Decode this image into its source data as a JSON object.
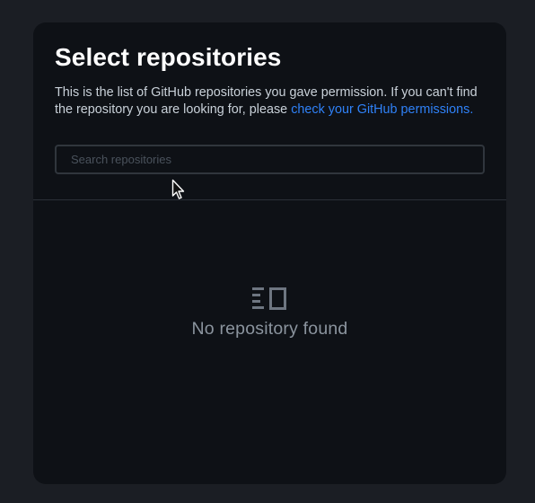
{
  "modal": {
    "title": "Select repositories",
    "description": "This is the list of GitHub repositories you gave permission. If you can't find the repository you are looking for, please ",
    "permissions_link": "check your GitHub permissions.",
    "search": {
      "placeholder": "Search repositories",
      "value": ""
    },
    "empty_state": {
      "icon": "repository-list-icon",
      "message": "No repository found"
    }
  },
  "colors": {
    "page_background": "#1b1e24",
    "modal_background": "#0e1116",
    "link": "#2f81f7",
    "muted_text": "#8b949e"
  }
}
